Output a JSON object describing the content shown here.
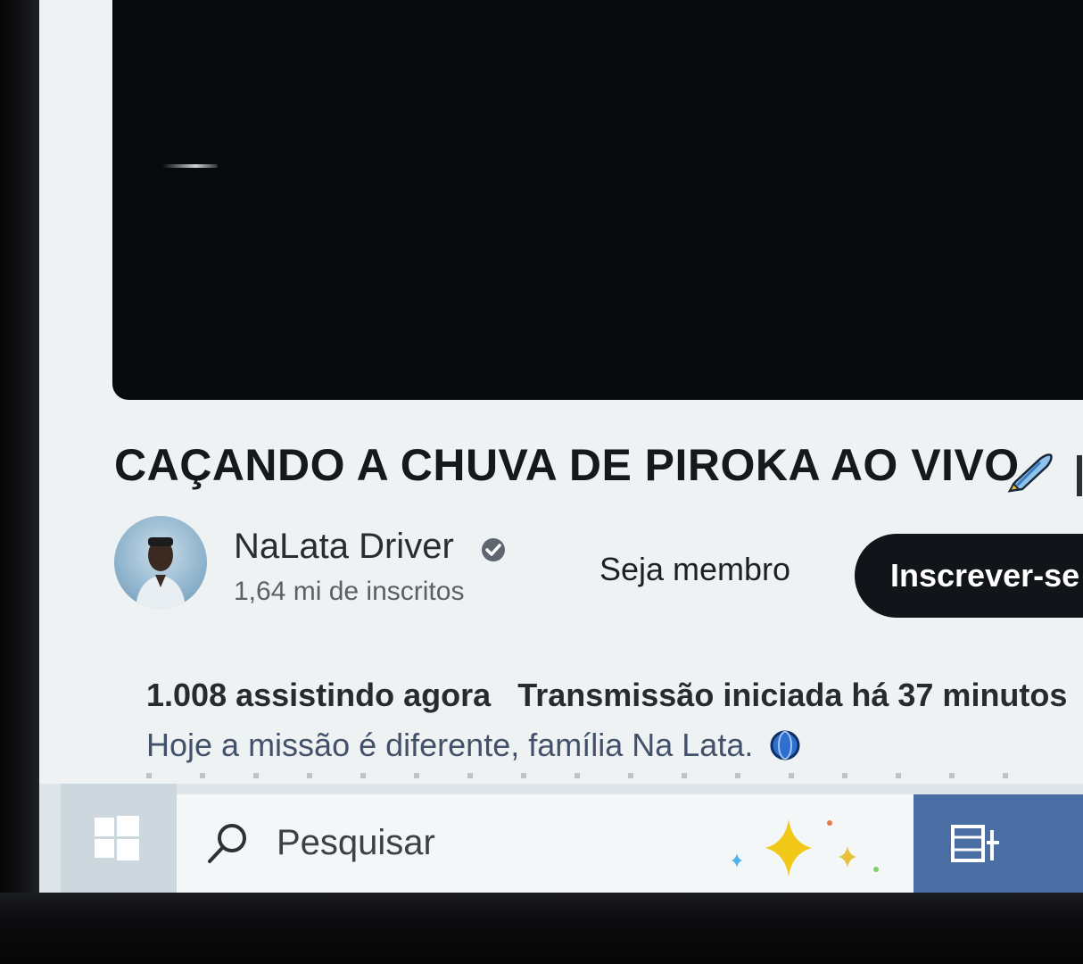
{
  "video": {
    "title": "CAÇANDO A CHUVA DE PIROKA AO VIVO",
    "title_emoji": "rocket-icon"
  },
  "channel": {
    "name": "NaLata Driver",
    "verified": true,
    "subscribers": "1,64 mi de inscritos"
  },
  "actions": {
    "join_label": "Seja membro",
    "subscribe_label": "Inscrever-se"
  },
  "description": {
    "viewers": "1.008 assistindo agora",
    "started": "Transmissão iniciada há 37 minutos",
    "hashtag": "#N",
    "text": "Hoje a missão é diferente, família Na Lata."
  },
  "taskbar": {
    "search_placeholder": "Pesquisar",
    "start_icon": "windows-logo-icon",
    "search_icon": "search-icon",
    "task_view_icon": "task-view-icon"
  },
  "colors": {
    "subscribe_bg": "#111418",
    "task_view_bg": "#4a6da4",
    "page_bg": "#eef2f3"
  }
}
